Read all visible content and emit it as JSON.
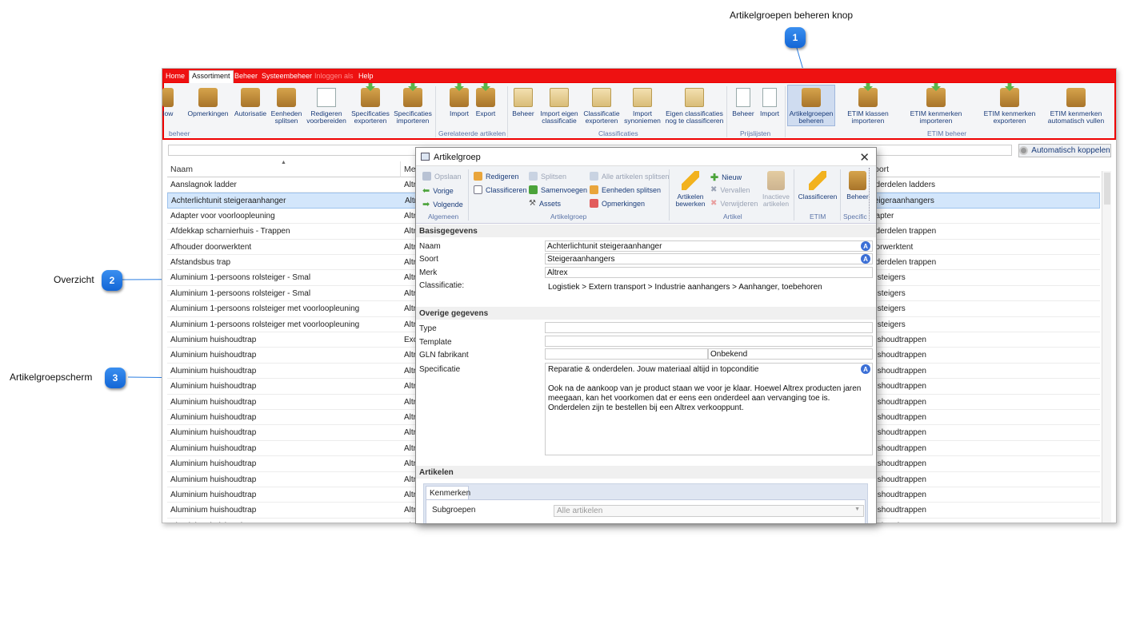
{
  "callouts": [
    {
      "number": "1",
      "label": "Artikelgroepen beheren knop"
    },
    {
      "number": "2",
      "label": "Overzicht"
    },
    {
      "number": "3",
      "label": "Artikelgroepscherm"
    }
  ],
  "menubar": {
    "tabs": [
      "Home",
      "Assortiment",
      "Beheer",
      "Systeembeheer",
      "Inloggen als",
      "Help"
    ],
    "active_tab": "Assortiment"
  },
  "ribbon": {
    "buttons": [
      {
        "label": "low",
        "icon": "box-icon"
      },
      {
        "label": "Opmerkingen",
        "icon": "comment-box-icon"
      },
      {
        "label": "Autorisatie",
        "icon": "box-icon"
      },
      {
        "label": "Eenheden splitsen",
        "icon": "split-icon"
      },
      {
        "label": "Redigeren voorbereiden",
        "icon": "checklist-icon"
      },
      {
        "label": "Specificaties exporteren",
        "icon": "box-export-icon"
      },
      {
        "label": "Specificaties importeren",
        "icon": "box-import-icon"
      },
      {
        "label": "Import",
        "icon": "box-import-icon"
      },
      {
        "label": "Export",
        "icon": "box-export-icon"
      },
      {
        "label": "Beheer",
        "icon": "folder-icon"
      },
      {
        "label": "Import eigen classificatie",
        "icon": "folder-import-icon"
      },
      {
        "label": "Classificatie exporteren",
        "icon": "folder-export-icon"
      },
      {
        "label": "Import synoniemen",
        "icon": "folder-import-icon"
      },
      {
        "label": "Eigen classificaties nog te classificeren",
        "icon": "folder-icon"
      },
      {
        "label": "Beheer",
        "icon": "price-doc-icon"
      },
      {
        "label": "Import",
        "icon": "price-import-icon"
      },
      {
        "label": "Artikelgroepen beheren",
        "icon": "box-gear-icon"
      },
      {
        "label": "ETIM klassen importeren",
        "icon": "box-import-icon"
      },
      {
        "label": "ETIM kenmerken importeren",
        "icon": "box-import-icon"
      },
      {
        "label": "ETIM kenmerken exporteren",
        "icon": "box-export-icon"
      },
      {
        "label": "ETIM kenmerken automatisch vullen",
        "icon": "box-gear-icon"
      }
    ],
    "groups": [
      "beheer",
      "Gerelateerde artikelen",
      "Classificaties",
      "Prijslijsten",
      "ETIM beheer"
    ]
  },
  "toolbar": {
    "auto_link_label": "Automatisch koppelen"
  },
  "grid": {
    "columns": [
      "Naam",
      "Me",
      "oort"
    ],
    "rows": [
      {
        "naam": "Aanslagnok ladder",
        "merk": "Altr",
        "soort": "nderdelen ladders"
      },
      {
        "naam": "Achterlichtunit steigeraanhanger",
        "merk": "Altr",
        "soort": "teigeraanhangers"
      },
      {
        "naam": "Adapter voor voorloopleuning",
        "merk": "Altr",
        "soort": "dapter"
      },
      {
        "naam": "Afdekkap scharnierhuis - Trappen",
        "merk": "Altr",
        "soort": "nderdelen trappen"
      },
      {
        "naam": "Afhouder doorwerktent",
        "merk": "Altr",
        "soort": "oorwerktent"
      },
      {
        "naam": "Afstandsbus trap",
        "merk": "Altr",
        "soort": "nderdelen trappen"
      },
      {
        "naam": "Aluminium 1-persoons rolsteiger - Smal",
        "merk": "Altr",
        "soort": "olsteigers"
      },
      {
        "naam": "Aluminium 1-persoons rolsteiger - Smal",
        "merk": "Altr",
        "soort": "olsteigers"
      },
      {
        "naam": "Aluminium 1-persoons rolsteiger met voorloopleuning",
        "merk": "Altr",
        "soort": "olsteigers"
      },
      {
        "naam": "Aluminium 1-persoons rolsteiger met voorloopleuning",
        "merk": "Altr",
        "soort": "olsteigers"
      },
      {
        "naam": "Aluminium huishoudtrap",
        "merk": "Exc",
        "soort": "uishoudtrappen"
      },
      {
        "naam": "Aluminium huishoudtrap",
        "merk": "Altr",
        "soort": "uishoudtrappen"
      },
      {
        "naam": "Aluminium huishoudtrap",
        "merk": "Altr",
        "soort": "uishoudtrappen"
      },
      {
        "naam": "Aluminium huishoudtrap",
        "merk": "Altr",
        "soort": "uishoudtrappen"
      },
      {
        "naam": "Aluminium huishoudtrap",
        "merk": "Altr",
        "soort": "uishoudtrappen"
      },
      {
        "naam": "Aluminium huishoudtrap",
        "merk": "Altr",
        "soort": "uishoudtrappen"
      },
      {
        "naam": "Aluminium huishoudtrap",
        "merk": "Altr",
        "soort": "uishoudtrappen"
      },
      {
        "naam": "Aluminium huishoudtrap",
        "merk": "Altr",
        "soort": "uishoudtrappen"
      },
      {
        "naam": "Aluminium huishoudtrap",
        "merk": "Altr",
        "soort": "uishoudtrappen"
      },
      {
        "naam": "Aluminium huishoudtrap",
        "merk": "Altr",
        "soort": "uishoudtrappen"
      },
      {
        "naam": "Aluminium huishoudtrap",
        "merk": "Altr",
        "soort": "uishoudtrappen"
      },
      {
        "naam": "Aluminium huishoudtrap",
        "merk": "Altr",
        "soort": "uishoudtrappen"
      },
      {
        "naam": "Aluminium huishoudtrap",
        "merk": "Altr",
        "soort": "uishoudtrappen"
      }
    ],
    "selected_row": 1
  },
  "dialog": {
    "title": "Artikelgroep",
    "ribbon": {
      "algemeen": {
        "opslaan": "Opslaan",
        "vorige": "Vorige",
        "volgende": "Volgende",
        "group": "Algemeen"
      },
      "artikelgroep": {
        "redigeren": "Redigeren",
        "classificeren": "Classificeren",
        "splitsen": "Splitsen",
        "samenvoegen": "Samenvoegen",
        "assets": "Assets",
        "alle_splitsen": "Alle artikelen splitsen",
        "eenheden_splitsen": "Eenheden splitsen",
        "opmerkingen": "Opmerkingen",
        "group": "Artikelgroep"
      },
      "artikel": {
        "bewerken": "Artikelen bewerken",
        "nieuw": "Nieuw",
        "vervallen": "Vervallen",
        "verwijderen": "Verwijderen",
        "inactieve": "Inactieve artikelen",
        "group": "Artikel"
      },
      "etim": {
        "classificeren": "Classificeren",
        "group": "ETIM"
      },
      "specific": {
        "beheer": "Beheer",
        "group": "Specific"
      }
    },
    "basis": {
      "section": "Basisgegevens",
      "naam_label": "Naam",
      "naam_value": "Achterlichtunit steigeraanhanger",
      "soort_label": "Soort",
      "soort_value": "Steigeraanhangers",
      "merk_label": "Merk",
      "merk_value": "Altrex",
      "classificatie_label": "Classificatie:",
      "classificatie_value": "Logistiek > Extern transport > Industrie aanhangers > Aanhanger, toebehoren"
    },
    "overige": {
      "section": "Overige gegevens",
      "type_label": "Type",
      "type_value": "",
      "template_label": "Template",
      "template_value": "",
      "gln_label": "GLN fabrikant",
      "gln_value": "",
      "gln_status": "Onbekend",
      "spec_label": "Specificatie",
      "spec_line1": "Reparatie & onderdelen. Jouw materiaal altijd in topconditie",
      "spec_para": "Ook na de aankoop van je product staan we voor je klaar. Hoewel Altrex producten jaren meegaan, kan het voorkomen dat er eens een onderdeel aan vervanging toe is. Onderdelen zijn te bestellen bij een Altrex verkooppunt."
    },
    "artikelen": {
      "section": "Artikelen",
      "tab": "Kenmerken",
      "subgroepen_label": "Subgroepen",
      "subgroepen_value": "Alle artikelen"
    }
  }
}
